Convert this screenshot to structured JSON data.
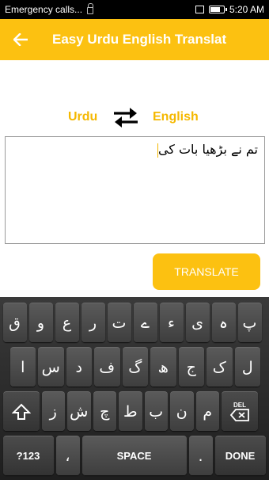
{
  "status_bar": {
    "notification": "Emergency calls...",
    "time": "5:20 AM",
    "battery_level": 0.8
  },
  "app_bar": {
    "title": "Easy Urdu English Translat",
    "back_icon": "arrow-left-icon"
  },
  "languages": {
    "source": "Urdu",
    "target": "English",
    "swap_icon": "swap-arrows-icon"
  },
  "input": {
    "value": "تم نے بڑھیا بات کی"
  },
  "translate_button": {
    "label": "TRANSLATE"
  },
  "keyboard": {
    "row1": [
      "ق",
      "و",
      "ع",
      "ر",
      "ت",
      "ے",
      "ء",
      "ی",
      "ہ",
      "پ"
    ],
    "row2": [
      "ا",
      "س",
      "د",
      "ف",
      "گ",
      "ھ",
      "ج",
      "ک",
      "ل"
    ],
    "row3": [
      "ز",
      "ش",
      "چ",
      "ط",
      "ب",
      "ن",
      "م"
    ],
    "shift_icon": "shift-arrow-icon",
    "delete_label": "DEL",
    "symbols_label": "?123",
    "comma_label": "،",
    "space_label": "SPACE",
    "period_label": ".",
    "done_label": "DONE"
  },
  "colors": {
    "accent": "#fcc111",
    "accent_text": "#f5b800",
    "keyboard_bg": "#2c2c2c"
  }
}
